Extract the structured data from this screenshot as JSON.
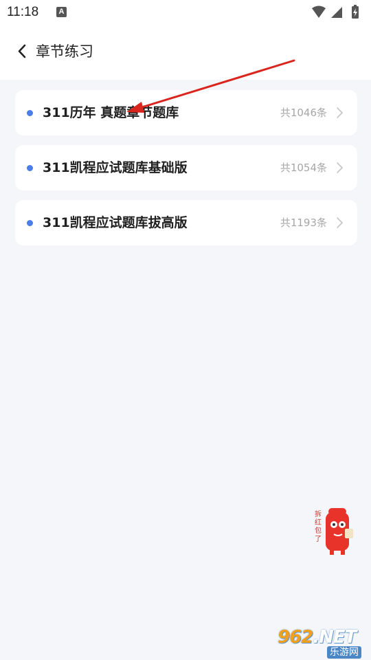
{
  "status_bar": {
    "time": "11:18",
    "notification_badge": "A",
    "icons": [
      "wifi-icon",
      "signal-icon",
      "battery-charging-icon"
    ]
  },
  "nav": {
    "title": "章节练习",
    "back_icon": "chevron-left-icon"
  },
  "items": [
    {
      "title": "311历年 真题章节题库",
      "count": "共1046条"
    },
    {
      "title": "311凯程应试题库基础版",
      "count": "共1054条"
    },
    {
      "title": "311凯程应试题库拔高版",
      "count": "共1193条"
    }
  ],
  "mascot": {
    "caption": "拆红包了"
  },
  "watermark": {
    "main_prefix": "962",
    "main_suffix": ".NET",
    "sub": "乐游网"
  },
  "colors": {
    "background": "#f5f6fa",
    "card": "#ffffff",
    "dot": "#4a7de8",
    "arrow": "#d9251d",
    "count_text": "#a6a6a6"
  }
}
